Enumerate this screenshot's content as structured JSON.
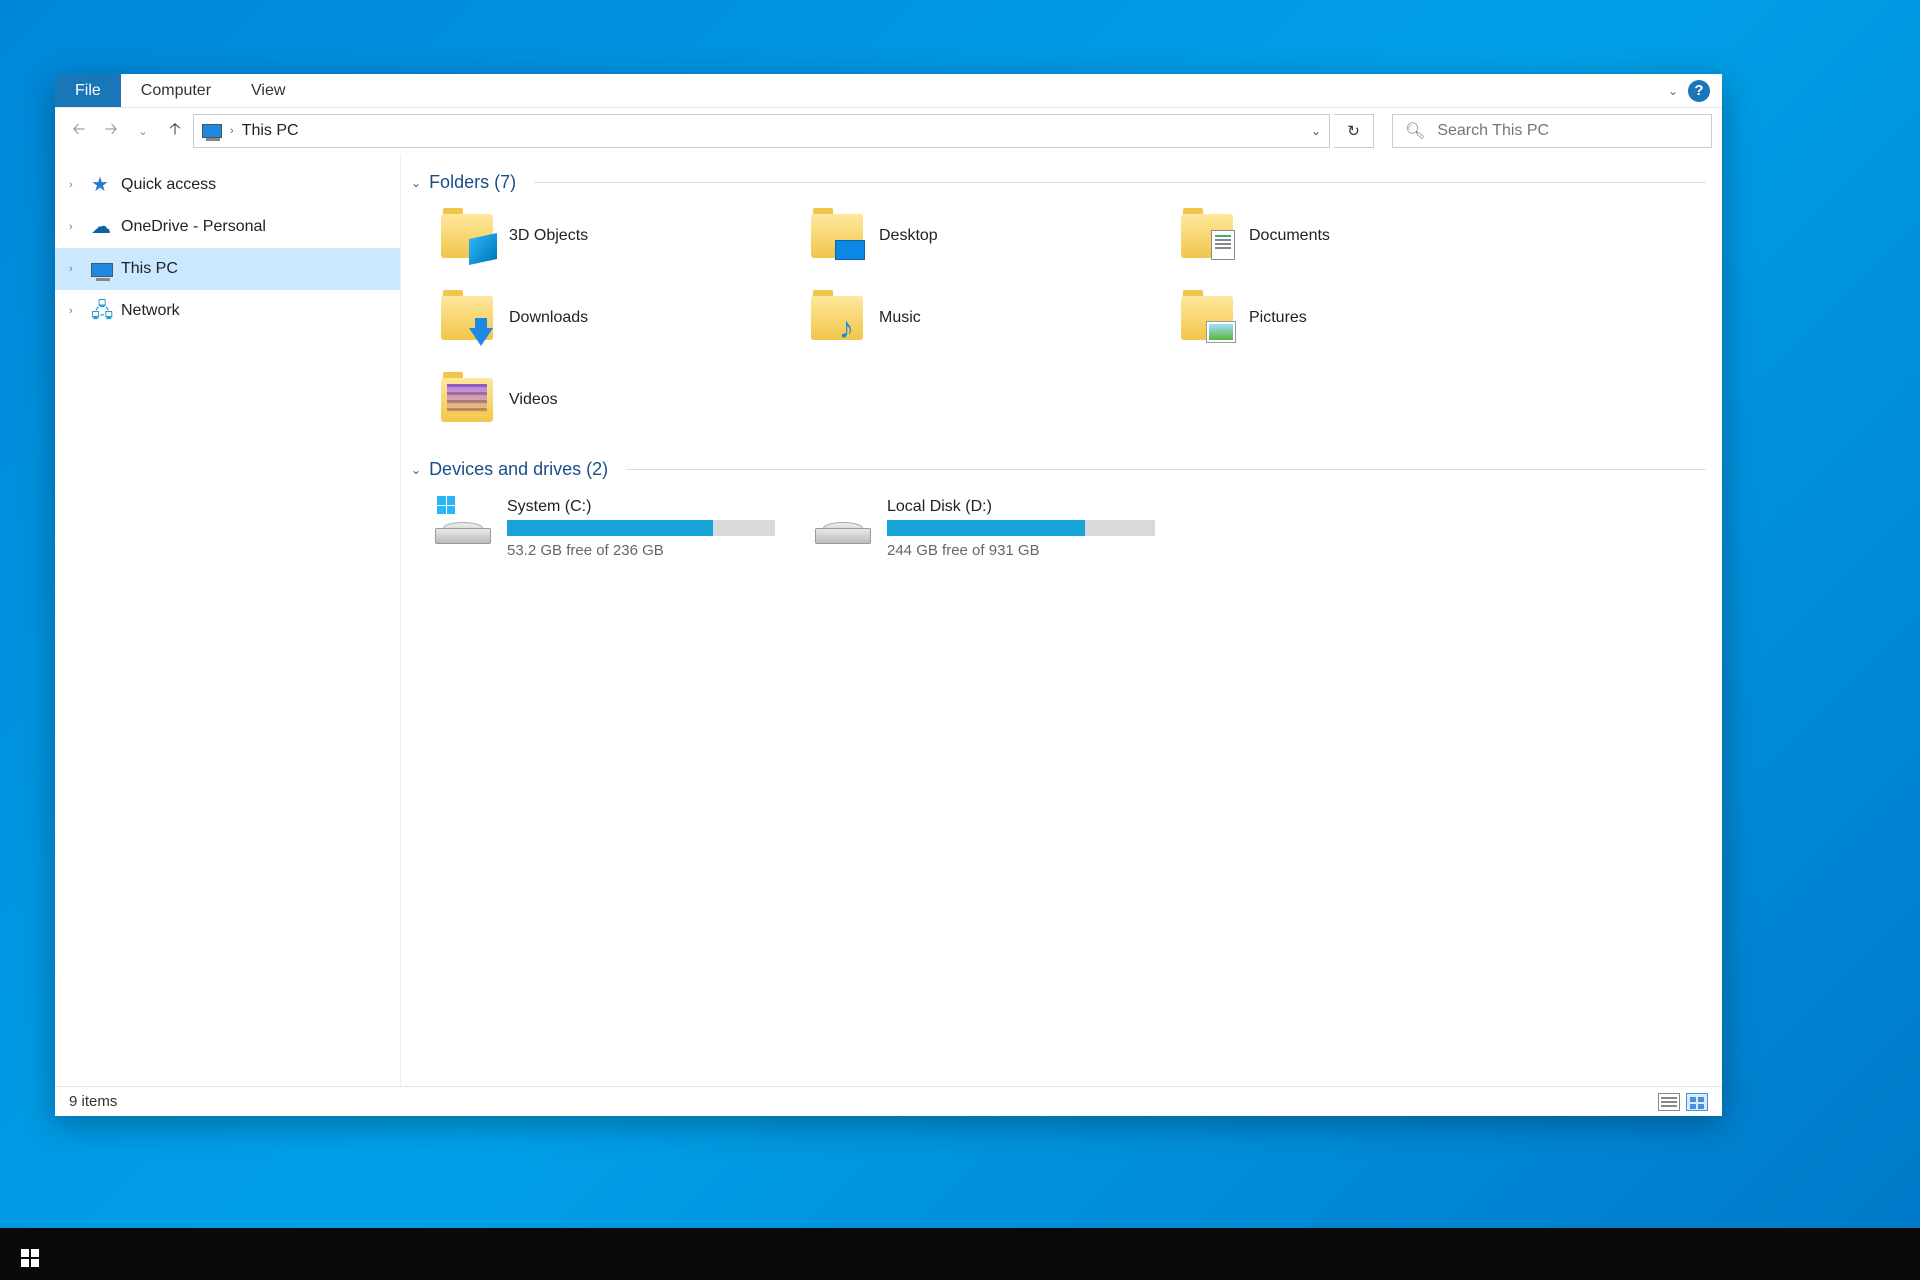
{
  "ribbon": {
    "tabs": [
      "File",
      "Computer",
      "View"
    ],
    "help_tooltip": "?"
  },
  "nav": {
    "location_label": "This PC",
    "search_placeholder": "Search This PC"
  },
  "sidebar": {
    "items": [
      {
        "label": "Quick access",
        "icon": "star",
        "selected": false
      },
      {
        "label": "OneDrive - Personal",
        "icon": "cloud",
        "selected": false
      },
      {
        "label": "This PC",
        "icon": "pc",
        "selected": true
      },
      {
        "label": "Network",
        "icon": "net",
        "selected": false
      }
    ]
  },
  "groups": {
    "folders": {
      "heading": "Folders (7)",
      "items": [
        {
          "label": "3D Objects",
          "overlay": "3d"
        },
        {
          "label": "Desktop",
          "overlay": "desktop"
        },
        {
          "label": "Documents",
          "overlay": "doc"
        },
        {
          "label": "Downloads",
          "overlay": "down"
        },
        {
          "label": "Music",
          "overlay": "music"
        },
        {
          "label": "Pictures",
          "overlay": "pic"
        },
        {
          "label": "Videos",
          "overlay": "vid"
        }
      ]
    },
    "drives": {
      "heading": "Devices and drives (2)",
      "items": [
        {
          "name": "System (C:)",
          "free_text": "53.2 GB free of 236 GB",
          "used_pct": 77,
          "has_win_badge": true
        },
        {
          "name": "Local Disk (D:)",
          "free_text": "244 GB free of 931 GB",
          "used_pct": 74,
          "has_win_badge": false
        }
      ]
    }
  },
  "statusbar": {
    "text": "9 items"
  }
}
